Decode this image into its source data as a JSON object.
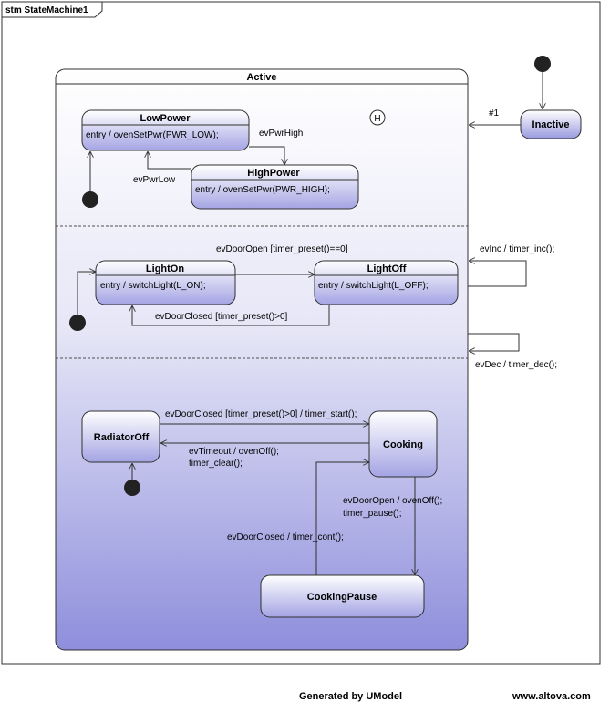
{
  "frame": {
    "title": "stm StateMachine1"
  },
  "composite": {
    "name": "Active"
  },
  "history": {
    "label": "H"
  },
  "states": {
    "low_power": {
      "name": "LowPower",
      "entry": "entry / ovenSetPwr(PWR_LOW);"
    },
    "high_power": {
      "name": "HighPower",
      "entry": "entry / ovenSetPwr(PWR_HIGH);"
    },
    "light_on": {
      "name": "LightOn",
      "entry": "entry / switchLight(L_ON);"
    },
    "light_off": {
      "name": "LightOff",
      "entry": "entry / switchLight(L_OFF);"
    },
    "radiator_off": {
      "name": "RadiatorOff"
    },
    "cooking": {
      "name": "Cooking"
    },
    "cooking_pause": {
      "name": "CookingPause"
    },
    "inactive": {
      "name": "Inactive"
    }
  },
  "transitions": {
    "ev_pwr_high": "evPwrHigh",
    "ev_pwr_low": "evPwrLow",
    "inactive_to_active": "#1",
    "door_open_light": "evDoorOpen [timer_preset()==0]",
    "door_closed_light": "evDoorClosed [timer_preset()>0]",
    "ev_inc": "evInc / timer_inc();",
    "ev_dec": "evDec / timer_dec();",
    "door_closed_start": "evDoorClosed [timer_preset()>0] / timer_start();",
    "timeout_line1": "evTimeout / ovenOff();",
    "timeout_line2": "timer_clear();",
    "door_open_pause_line1": "evDoorOpen / ovenOff();",
    "door_open_pause_line2": "timer_pause();",
    "door_closed_cont": "evDoorClosed / timer_cont();"
  },
  "footer": {
    "generated": "Generated by UModel",
    "site": "www.altova.com"
  },
  "colors": {
    "state_top": "#ffffff",
    "state_bottom": "#9c9ce0",
    "active_bottom": "#8e8edc",
    "stroke": "#303030"
  }
}
